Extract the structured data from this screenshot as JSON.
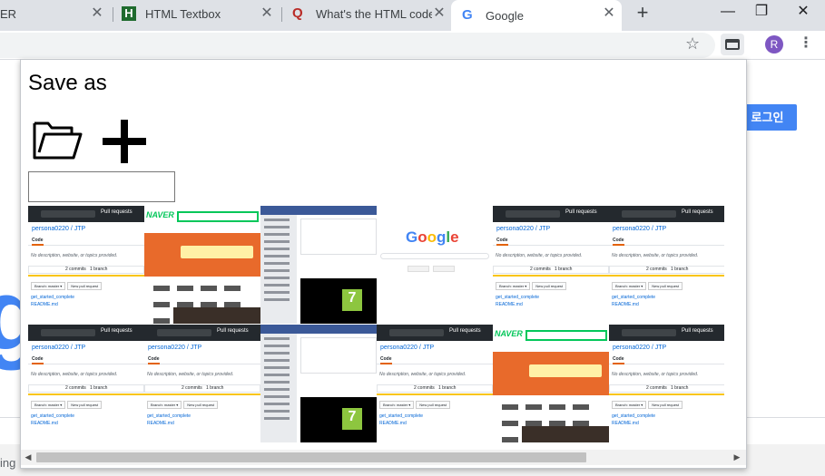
{
  "browser": {
    "tabs": [
      {
        "title": "ER",
        "favicon": "none",
        "active": false
      },
      {
        "title": "HTML Textbox",
        "favicon": "h-icon",
        "active": false
      },
      {
        "title": "What's the HTML code",
        "favicon": "quora-icon",
        "active": false
      },
      {
        "title": "Google",
        "favicon": "google-icon",
        "active": true
      }
    ],
    "tab_close_glyph": "✕",
    "new_tab_glyph": "+",
    "window_buttons": {
      "minimize": "—",
      "restore": "❐",
      "close": "✕"
    },
    "toolbar": {
      "star_glyph": "☆",
      "avatar_letter": "R",
      "menu_glyph": "⋮"
    }
  },
  "page": {
    "login_button": "로그인",
    "google_partial_letter": "g",
    "footer_partial": "ing"
  },
  "popup": {
    "title": "Save as",
    "folder_icon": "folder-icon",
    "add_icon": "plus-icon",
    "textbox_value": "",
    "thumbnails": [
      {
        "kind": "github",
        "repo": "persona0220 / JTP"
      },
      {
        "kind": "naver",
        "logo": "NAVER"
      },
      {
        "kind": "facebook"
      },
      {
        "kind": "google",
        "logo": "Google"
      },
      {
        "kind": "github",
        "repo": "persona0220 / JTP"
      },
      {
        "kind": "github",
        "repo": "persona0220 / JTP"
      },
      {
        "kind": "github",
        "repo": "persona0220 / JTP"
      },
      {
        "kind": "github",
        "repo": "persona0220 / JTP"
      },
      {
        "kind": "facebook"
      },
      {
        "kind": "github",
        "repo": "persona0220 / JTP"
      },
      {
        "kind": "naver",
        "logo": "NAVER"
      },
      {
        "kind": "github",
        "repo": "persona0220 / JTP"
      }
    ],
    "github_text": {
      "code_tab": "Code",
      "description": "No description, website, or topics provided.",
      "commits": "2 commits",
      "branch": "1 branch",
      "branch_btn": "Branch: master ▾",
      "new_pr": "New pull request",
      "file1": "get_started_complete",
      "file2": "README.md",
      "pull_requests": "Pull requests"
    }
  },
  "scrollbar": {
    "left_arrow": "◀",
    "right_arrow": "▶"
  }
}
